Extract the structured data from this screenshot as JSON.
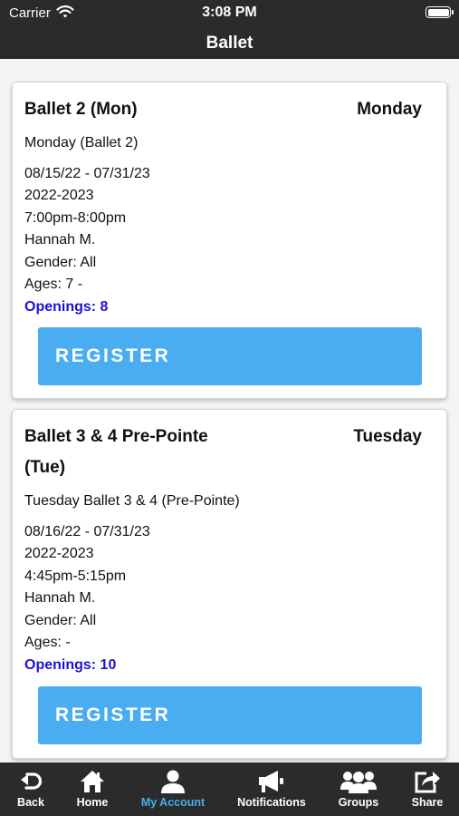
{
  "status_bar": {
    "carrier": "Carrier",
    "time": "3:08 PM"
  },
  "nav": {
    "title": "Ballet"
  },
  "classes": [
    {
      "title_line1": "Ballet 2 (Mon)",
      "title_line2": "",
      "day": "Monday",
      "description": "Monday (Ballet 2)",
      "date_range": "08/15/22 - 07/31/23",
      "season": "2022-2023",
      "time": "7:00pm-8:00pm",
      "instructor": "Hannah M.",
      "gender": "Gender: All",
      "ages": "Ages: 7 -",
      "openings": "Openings: 8",
      "register_label": "REGISTER"
    },
    {
      "title_line1": "Ballet 3 & 4 Pre-Pointe",
      "title_line2": "(Tue)",
      "day": "Tuesday",
      "description": "Tuesday Ballet 3 & 4 (Pre-Pointe)",
      "date_range": "08/16/22 - 07/31/23",
      "season": "2022-2023",
      "time": "4:45pm-5:15pm",
      "instructor": "Hannah M.",
      "gender": "Gender: All",
      "ages": "Ages: -",
      "openings": "Openings: 10",
      "register_label": "REGISTER"
    }
  ],
  "tab_bar": {
    "active": "my_account",
    "active_color": "#4aadf2",
    "tabs": [
      {
        "id": "back",
        "label": "Back",
        "icon": "back-arrow-icon"
      },
      {
        "id": "home",
        "label": "Home",
        "icon": "home-icon"
      },
      {
        "id": "my_account",
        "label": "My Account",
        "icon": "user-icon"
      },
      {
        "id": "notifications",
        "label": "Notifications",
        "icon": "megaphone-icon"
      },
      {
        "id": "groups",
        "label": "Groups",
        "icon": "groups-icon"
      },
      {
        "id": "share",
        "label": "Share",
        "icon": "share-icon"
      }
    ]
  }
}
